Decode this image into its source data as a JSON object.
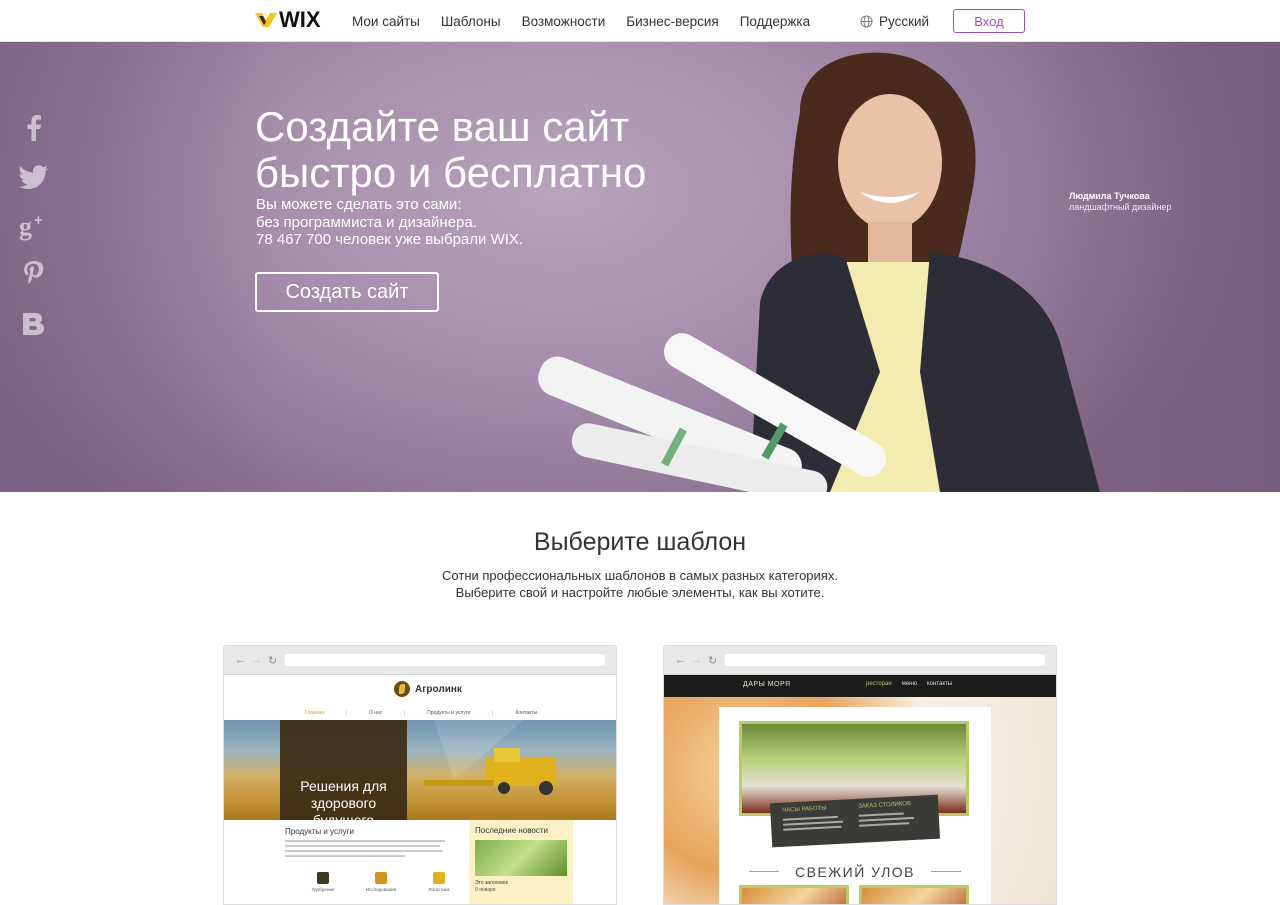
{
  "nav": {
    "logo": "WIX",
    "links": [
      "Мои сайты",
      "Шаблоны",
      "Возможности",
      "Бизнес-версия",
      "Поддержка"
    ],
    "language": "Русский",
    "login": "Вход"
  },
  "social": [
    "facebook-icon",
    "twitter-icon",
    "google-plus-icon",
    "pinterest-icon",
    "vk-icon"
  ],
  "hero": {
    "title_lines": [
      "Создайте ваш сайт",
      "быстро и бесплатно"
    ],
    "subtitle_lines": [
      "Вы можете сделать это сами:",
      "без программиста и дизайнера.",
      "78 467 700 человек уже выбрали WIX."
    ],
    "cta": "Создать сайт",
    "person_name": "Людмила Тучкова",
    "person_role": "ландшафтный дизайнер"
  },
  "templates": {
    "title": "Выберите шаблон",
    "subtitle_lines": [
      "Сотни профессиональных шаблонов в самых разных категориях.",
      "Выберите свой и настройте любые элементы, как вы хотите."
    ],
    "agro": {
      "name": "Агролинк",
      "menu": [
        "Главная",
        "О нас",
        "Продукты и услуги",
        "Контакты"
      ],
      "banner_lines": [
        "Решения для здорового",
        "будущего"
      ],
      "products_title": "Продукты и услуги",
      "icons": [
        "Удобрения",
        "Исследования",
        "Логистика"
      ],
      "news_title": "Последние новости",
      "news_heading": "Это заголовок",
      "news_date": "9 января"
    },
    "restaurant": {
      "name": "ДАРЫ МОРЯ",
      "menu": [
        "ресторан",
        "меню",
        "контакты"
      ],
      "hours_title": "ЧАСЫ РАБОТЫ",
      "order_title": "ЗАКАЗ СТОЛИКОВ",
      "catch": "СВЕЖИЙ УЛОВ"
    }
  },
  "colors": {
    "accent": "#a04fb8",
    "hero_bg": "#a58cab",
    "logo_yellow": "#f5c518"
  }
}
